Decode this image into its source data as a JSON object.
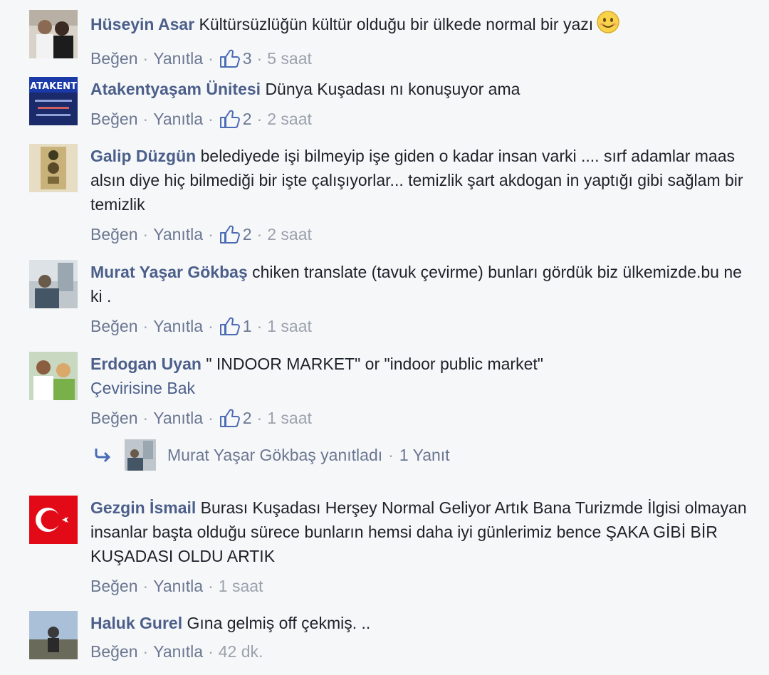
{
  "labels": {
    "like": "Beğen",
    "reply": "Yanıtla",
    "separator": "·"
  },
  "comments": [
    {
      "author": "Hüseyin Asar",
      "text": "Kültürsüzlüğün kültür olduğu bir ülkede normal bir yazı",
      "emoji": "smiley-emoji",
      "likes": "3",
      "time": "5 saat"
    },
    {
      "author": "Atakentyaşam Ünitesi",
      "text": "Dünya Kuşadası nı konuşuyor ama",
      "likes": "2",
      "time": "2 saat",
      "avatar_text": "ATAKENT"
    },
    {
      "author": "Galip Düzgün",
      "text": "belediyede işi bilmeyip işe giden o kadar insan varki .... sırf adamlar maas alsın diye hiç bilmediği bir işte çalışıyorlar... temizlik şart akdogan in yaptığı gibi sağlam bir temizlik",
      "likes": "2",
      "time": "2 saat"
    },
    {
      "author": "Murat Yaşar Gökbaş",
      "text": "chiken translate (tavuk çevirme) bunları gördük biz ülkemizde.bu ne ki .",
      "likes": "1",
      "time": "1 saat"
    },
    {
      "author": "Erdogan Uyan",
      "text": "\" INDOOR MARKET\" or \"indoor public market\"",
      "translate": "Çevirisine Bak",
      "likes": "2",
      "time": "1 saat",
      "reply": {
        "text": "Murat Yaşar Gökbaş yanıtladı",
        "count": "1 Yanıt"
      }
    },
    {
      "author": "Gezgin İsmail",
      "text": "Burası Kuşadası Herşey Normal Geliyor Artık Bana Turizmde İlgisi olmayan insanlar başta olduğu sürece bunların hemsi daha iyi günlerimiz bence ŞAKA GİBİ BİR KUŞADASI OLDU ARTIK",
      "time": "1 saat"
    },
    {
      "author": "Haluk Gurel",
      "text": "Gına gelmiş off çekmiş. ..",
      "time": "42 dk."
    }
  ],
  "colors": {
    "author": "#4b5f8a",
    "meta": "#8e96a3",
    "background": "#f6f7f9"
  }
}
